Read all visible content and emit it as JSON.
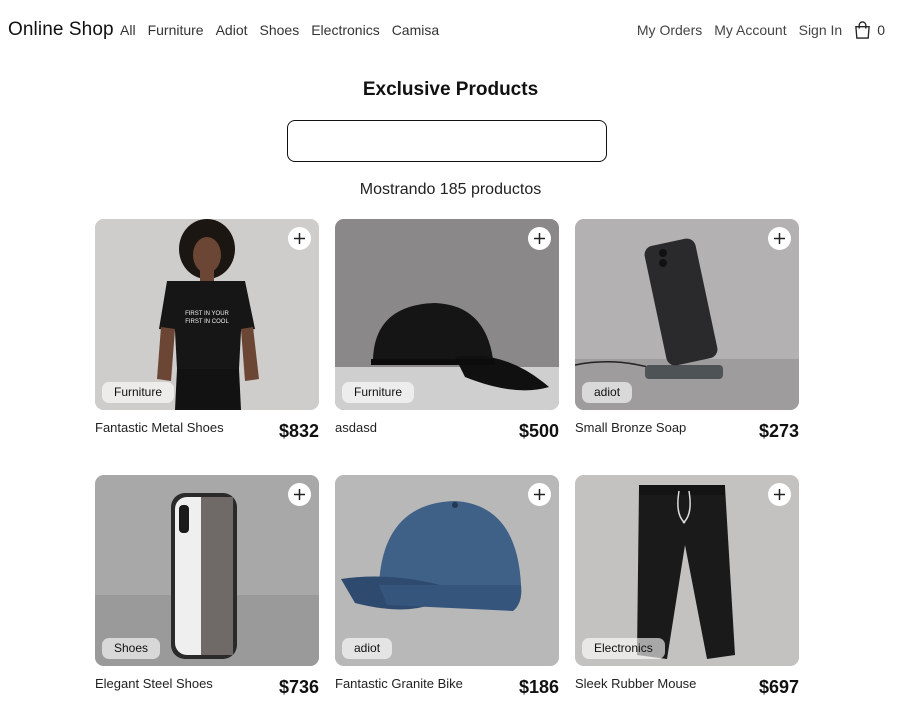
{
  "nav": {
    "brand": "Online Shop",
    "categories": [
      "All",
      "Furniture",
      "Adiot",
      "Shoes",
      "Electronics",
      "Camisa"
    ],
    "my_orders": "My Orders",
    "my_account": "My Account",
    "sign_in": "Sign In",
    "cart_count": "0"
  },
  "main": {
    "title": "Exclusive Products",
    "search_placeholder": "",
    "results_text": "Mostrando 185 productos"
  },
  "products": [
    {
      "name": "Fantastic Metal Shoes",
      "price": "$832",
      "category": "Furniture",
      "image": "woman-black-tshirt"
    },
    {
      "name": "asdasd",
      "price": "$500",
      "category": "Furniture",
      "image": "black-cap"
    },
    {
      "name": "Small Bronze Soap",
      "price": "$273",
      "category": "adiot",
      "image": "phone-on-stand"
    },
    {
      "name": "Elegant Steel Shoes",
      "price": "$736",
      "category": "Shoes",
      "image": "silver-phone"
    },
    {
      "name": "Fantastic Granite Bike",
      "price": "$186",
      "category": "adiot",
      "image": "blue-cap"
    },
    {
      "name": "Sleek Rubber Mouse",
      "price": "$697",
      "category": "Electronics",
      "image": "black-joggers"
    }
  ],
  "icons": {
    "cart": "shopping-bag-icon",
    "add": "plus-icon"
  }
}
